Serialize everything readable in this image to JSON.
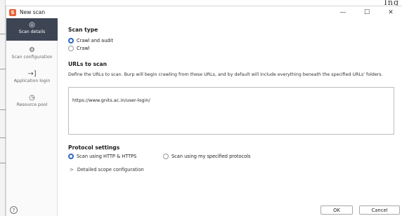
{
  "background_window": {
    "corner_text": "Ing"
  },
  "titlebar": {
    "app_icon": "burp-logo-icon",
    "title": "New scan",
    "minimize_glyph": "—",
    "maximize_glyph": "☐",
    "close_glyph": "✕"
  },
  "sidebar": {
    "items": [
      {
        "label": "Scan details",
        "icon": "crosshair-icon",
        "glyph": "◎",
        "active": true
      },
      {
        "label": "Scan configuration",
        "icon": "gear-icon",
        "glyph": "⚙",
        "active": false
      },
      {
        "label": "Application login",
        "icon": "login-arrow-icon",
        "glyph": "→]",
        "active": false
      },
      {
        "label": "Resource pool",
        "icon": "gauge-icon",
        "glyph": "◷",
        "active": false
      }
    ],
    "help_glyph": "?"
  },
  "scan_type": {
    "heading": "Scan type",
    "options": [
      {
        "label": "Crawl and audit",
        "selected": true
      },
      {
        "label": "Crawl",
        "selected": false
      }
    ]
  },
  "urls": {
    "heading": "URLs to scan",
    "description": "Define the URLs to scan. Burp will begin crawling from these URLs, and by default will include everything beneath the specified URLs' folders.",
    "value": "https://www.gnits.ac.in/user-login/"
  },
  "protocol": {
    "heading": "Protocol settings",
    "options": [
      {
        "label": "Scan using HTTP & HTTPS",
        "selected": true
      },
      {
        "label": "Scan using my specified protocols",
        "selected": false
      }
    ]
  },
  "scope": {
    "label": "Detailed scope configuration",
    "chevron": ">"
  },
  "buttons": {
    "ok": "OK",
    "cancel": "Cancel"
  },
  "colors": {
    "accent": "#2e68c0",
    "sidebar_active": "#3d4554",
    "app_icon": "#e8633a"
  }
}
